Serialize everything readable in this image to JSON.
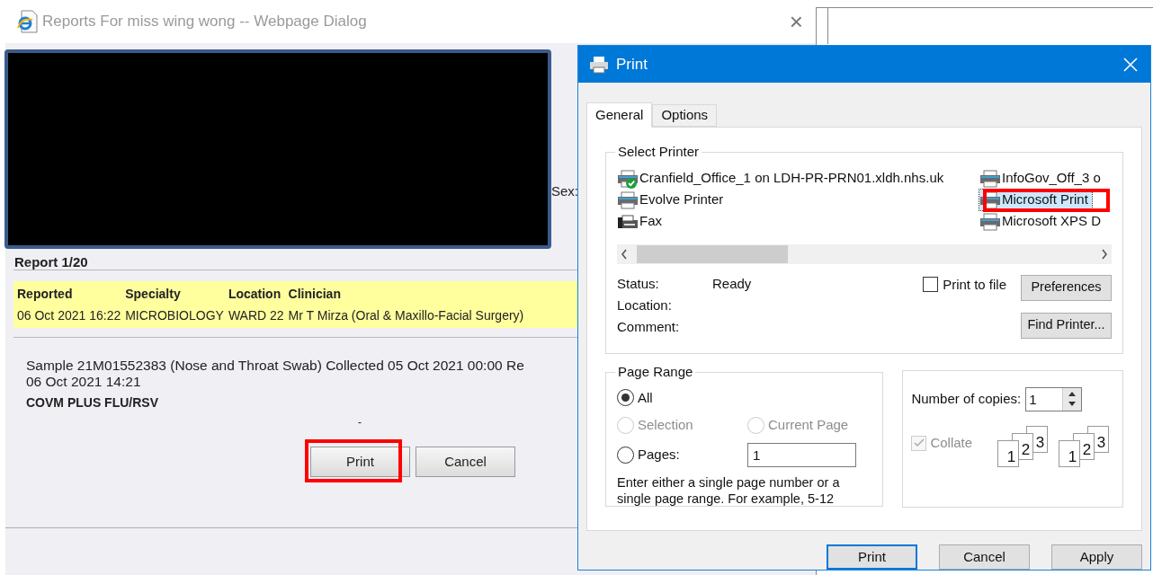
{
  "report_dialog": {
    "title": "Reports For miss wing wong -- Webpage Dialog",
    "close": "×",
    "sex_label": "Sex:",
    "report_counter": "Report 1/20",
    "table": {
      "columns": [
        "Reported",
        "Specialty",
        "Location",
        "Clinician"
      ],
      "rows": [
        [
          "06 Oct 2021 16:22",
          "MICROBIOLOGY",
          "WARD 22",
          "Mr T Mirza (Oral & Maxillo-Facial Surgery)"
        ]
      ]
    },
    "sample_lines": [
      "Sample 21M01552383 (Nose and Throat Swab) Collected 05 Oct 2021 00:00 Re",
      "06 Oct 2021 14:21"
    ],
    "test_name": "COVM PLUS FLU/RSV",
    "dash": "-",
    "buttons": [
      {
        "label": "Print",
        "highlighted": true
      },
      {
        "label": "Cancel",
        "highlighted": false
      }
    ]
  },
  "print_dialog": {
    "title": "Print",
    "tabs": [
      {
        "label": "General",
        "selected": true
      },
      {
        "label": "Options",
        "selected": false
      }
    ],
    "select_printer": {
      "legend": "Select Printer",
      "printers": [
        {
          "name": "Cranfield_Office_1 on LDH-PR-PRN01.xldh.nhs.uk",
          "kind": "printer",
          "default": true,
          "selected": false,
          "highlighted": false
        },
        {
          "name": "Evolve Printer",
          "kind": "printer",
          "default": false,
          "selected": false,
          "highlighted": false
        },
        {
          "name": "Fax",
          "kind": "fax",
          "default": false,
          "selected": false,
          "highlighted": false
        },
        {
          "name": "InfoGov_Off_3 o",
          "kind": "printer",
          "default": false,
          "selected": false,
          "highlighted": false
        },
        {
          "name": "Microsoft Print",
          "kind": "printer",
          "default": false,
          "selected": true,
          "highlighted": true
        },
        {
          "name": "Microsoft XPS D",
          "kind": "printer",
          "default": false,
          "selected": false,
          "highlighted": false
        }
      ],
      "status": [
        {
          "label": "Status:",
          "value": "Ready"
        },
        {
          "label": "Location:"
        },
        {
          "label": "Comment:"
        }
      ],
      "print_to_file": {
        "label": "Print to file",
        "checked": false
      },
      "buttons": [
        "Preferences",
        "Find Printer..."
      ]
    },
    "page_range": {
      "legend": "Page Range",
      "options": [
        {
          "label": "All",
          "selected": true,
          "disabled": false
        },
        {
          "label": "Selection",
          "selected": false,
          "disabled": true
        },
        {
          "label": "Current Page",
          "selected": false,
          "disabled": true
        },
        {
          "label": "Pages:",
          "selected": false,
          "disabled": false,
          "value": "1"
        }
      ],
      "hint": "Enter either a single page number or a single page range.  For example, 5-12"
    },
    "copies": {
      "label": "Number of copies:",
      "value": "1",
      "collate": {
        "label": "Collate",
        "checked": true,
        "disabled": true
      },
      "collate_stacks": [
        [
          "1",
          "2",
          "3"
        ],
        [
          "1",
          "2",
          "3"
        ]
      ]
    },
    "buttons": [
      {
        "label": "Print",
        "default": true
      },
      {
        "label": "Cancel",
        "default": false
      },
      {
        "label": "Apply",
        "default": false
      }
    ]
  }
}
